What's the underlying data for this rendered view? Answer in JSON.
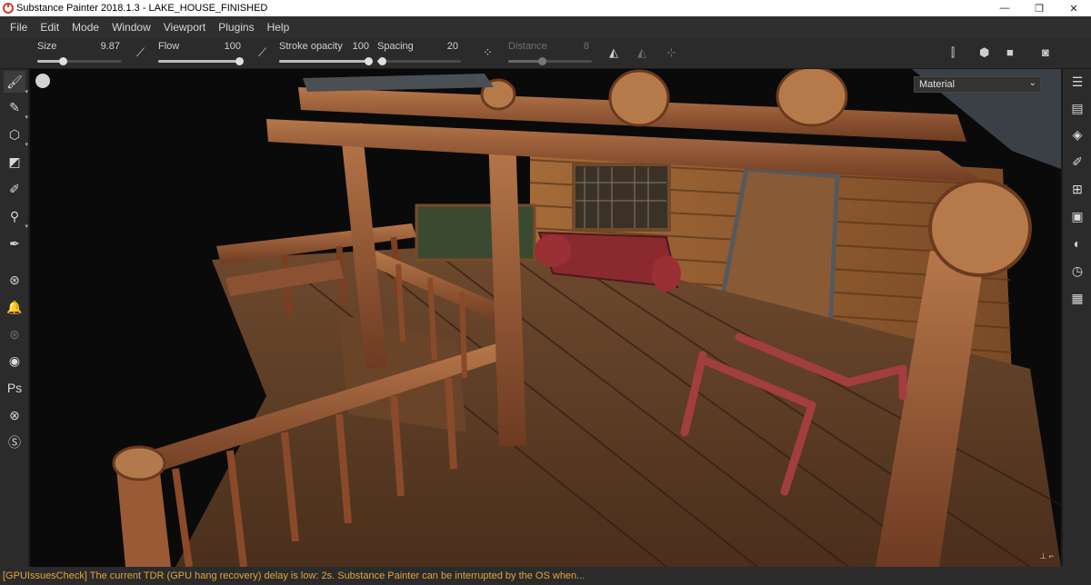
{
  "window": {
    "title": "Substance Painter 2018.1.3 - LAKE_HOUSE_FINISHED",
    "minimize": "—",
    "maximize": "❐",
    "close": "✕"
  },
  "menu": [
    "File",
    "Edit",
    "Mode",
    "Window",
    "Viewport",
    "Plugins",
    "Help"
  ],
  "toolbar": {
    "size_label": "Size",
    "size_value": "9.87",
    "size_fill": 0.3,
    "flow_label": "Flow",
    "flow_value": "100",
    "flow_fill": 1.0,
    "stroke_opacity_label": "Stroke opacity",
    "stroke_opacity_value": "100",
    "stroke_opacity_fill": 1.0,
    "spacing_label": "Spacing",
    "spacing_value": "20",
    "spacing_fill": 0.05,
    "distance_label": "Distance",
    "distance_value": "8",
    "distance_fill": 0.4
  },
  "viewport": {
    "material_select": "Material"
  },
  "status": {
    "message": "[GPUIssuesCheck] The current TDR (GPU hang recovery) delay is low: 2s. Substance Painter can be interrupted by the OS when..."
  },
  "colors": {
    "status_warning": "#e2a33d",
    "panel": "#2b2b2b"
  }
}
